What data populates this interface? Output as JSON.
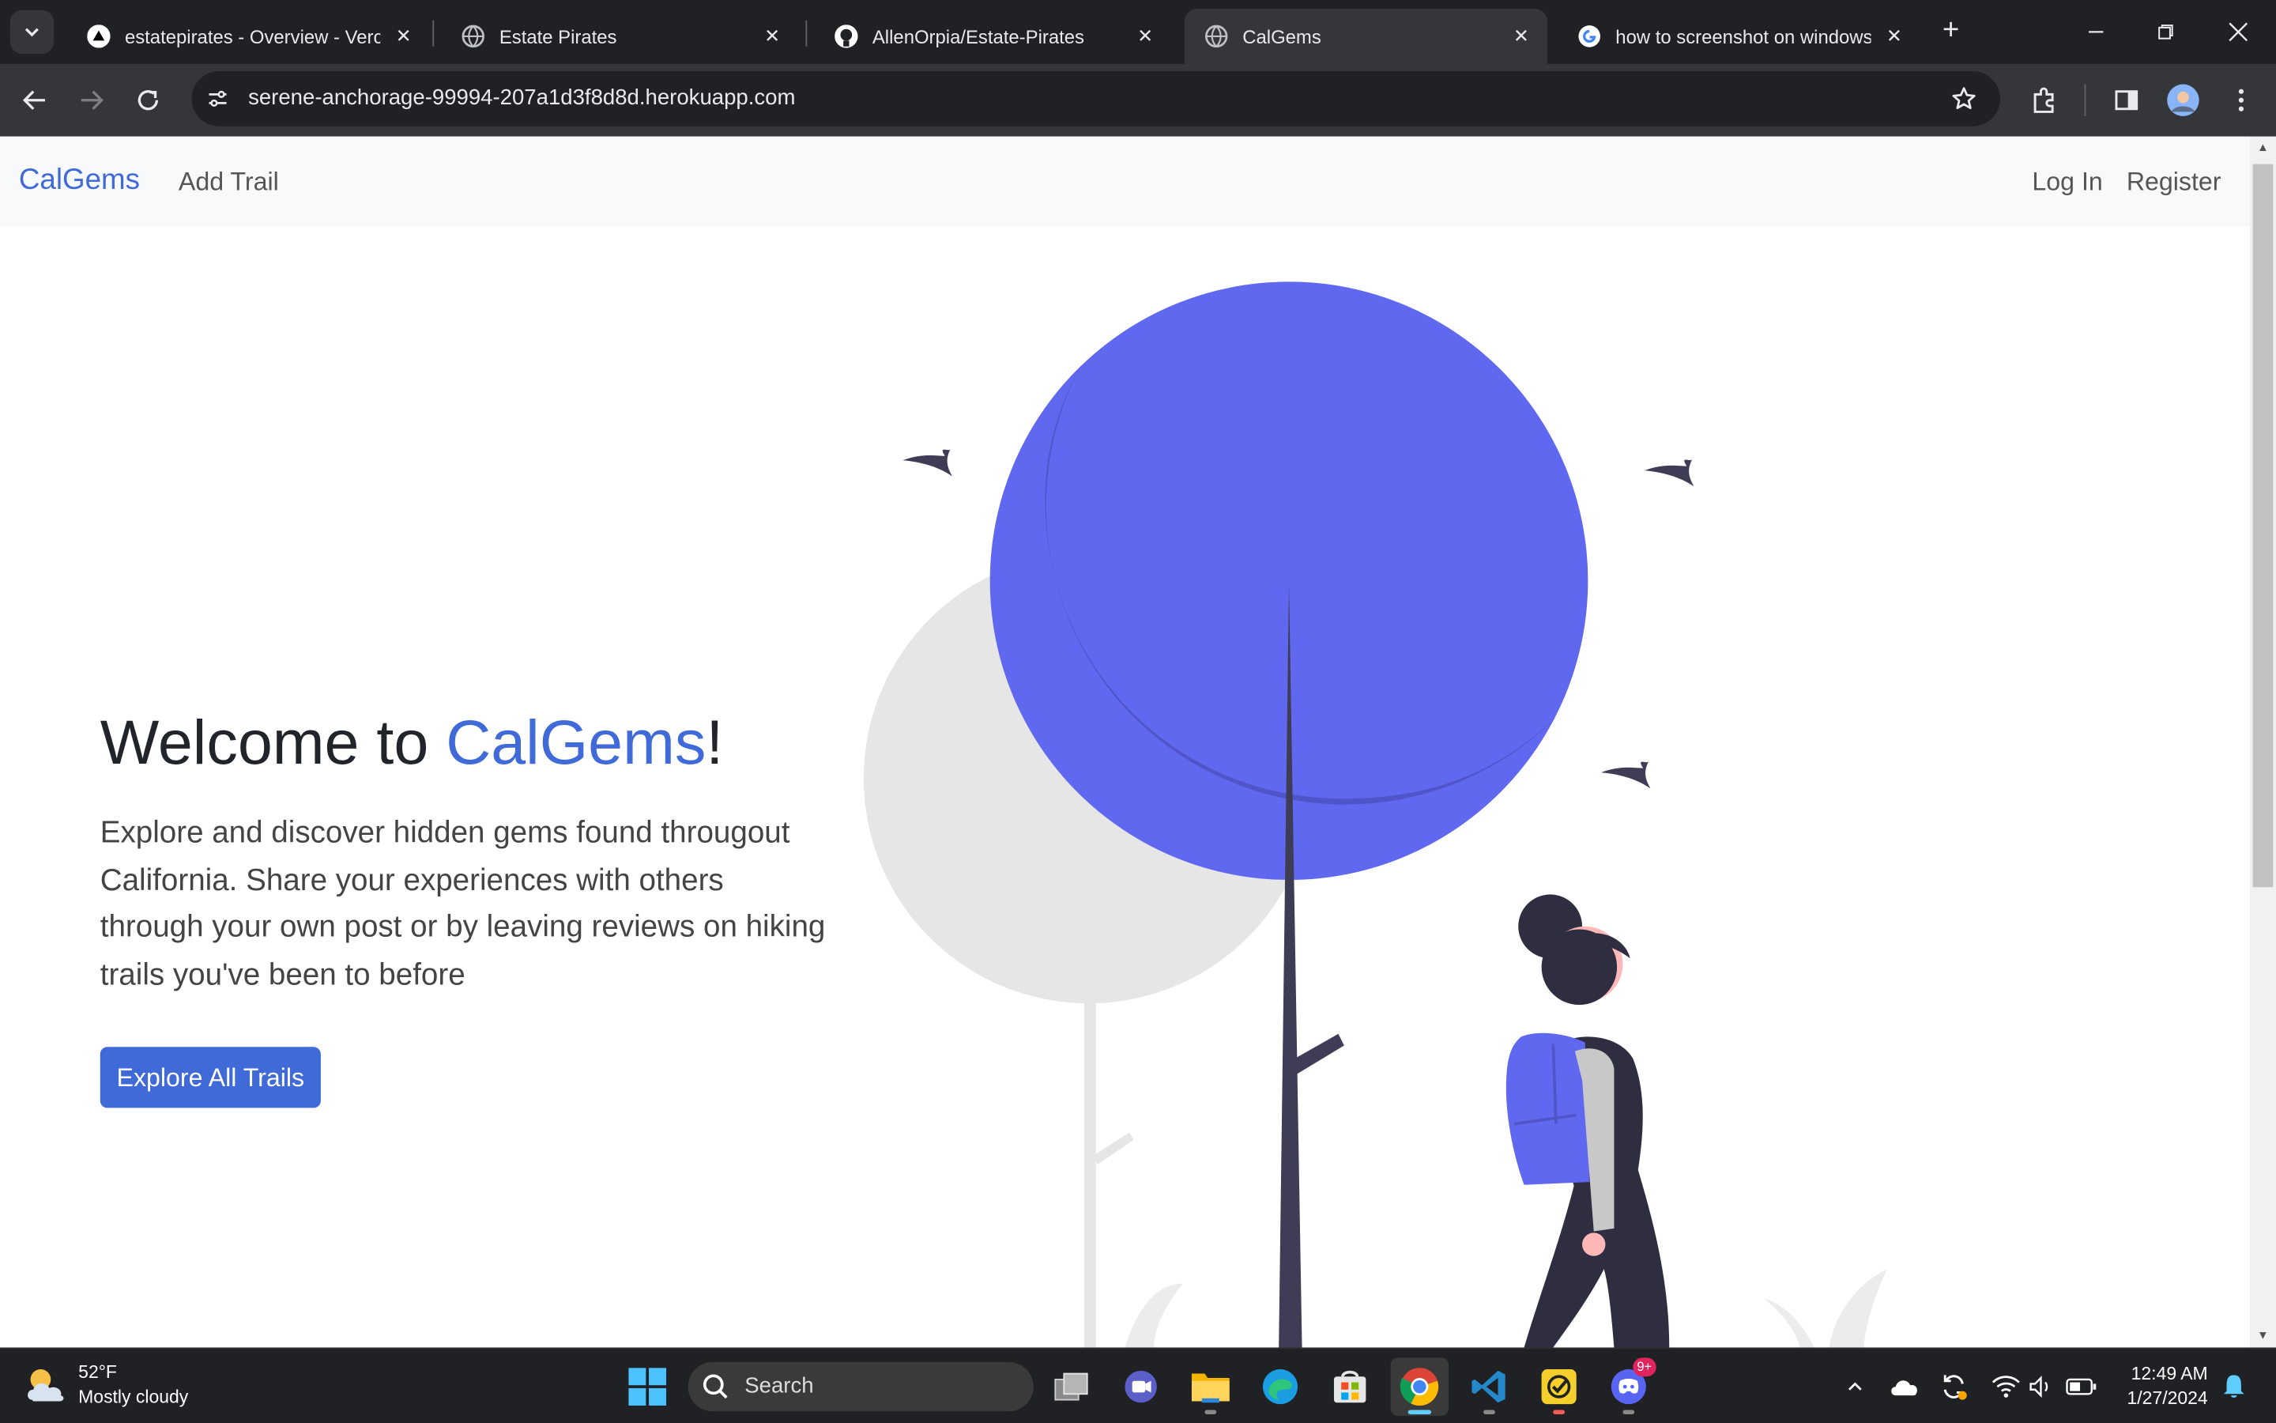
{
  "browser": {
    "tabs": [
      {
        "title": "estatepirates - Overview - Vercel",
        "favicon": "vercel-icon",
        "active": false
      },
      {
        "title": "Estate Pirates",
        "favicon": "globe-icon",
        "active": false
      },
      {
        "title": "AllenOrpia/Estate-Pirates",
        "favicon": "github-icon",
        "active": false
      },
      {
        "title": "CalGems",
        "favicon": "globe-icon",
        "active": true
      },
      {
        "title": "how to screenshot on windows",
        "favicon": "google-icon",
        "active": false
      }
    ],
    "url": "serene-anchorage-99994-207a1d3f8d8d.herokuapp.com"
  },
  "site": {
    "nav": {
      "brand": "CalGems",
      "add_trail": "Add Trail",
      "login": "Log In",
      "register": "Register"
    },
    "hero": {
      "title_prefix": "Welcome to ",
      "title_accent": "CalGems",
      "title_suffix": "!",
      "description": "Explore and discover hidden gems found througout California. Share your experiences with others through your own post or by leaving reviews on hiking trails you've been to before",
      "cta_label": "Explore All Trails"
    },
    "colors": {
      "accent": "#3f6ad8",
      "tree_main": "#6068f0",
      "tree_shade": "#4f55c8",
      "dark": "#2f2e41"
    }
  },
  "taskbar": {
    "weather_temp": "52°F",
    "weather_desc": "Mostly cloudy",
    "search_label": "Search",
    "time": "12:49 AM",
    "date": "1/27/2024",
    "discord_badge": "9+"
  }
}
